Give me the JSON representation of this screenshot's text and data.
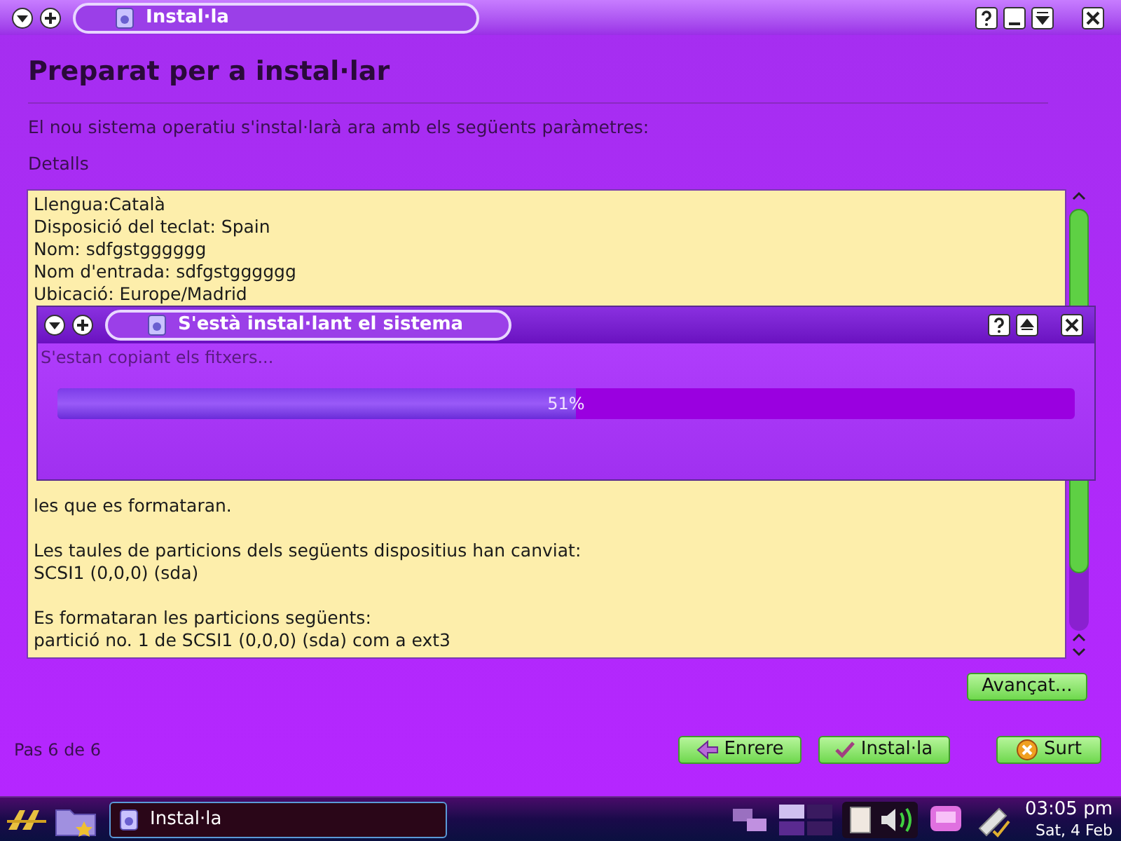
{
  "window": {
    "title": "Instal·la"
  },
  "page": {
    "heading": "Preparat per a instal·lar",
    "intro": "El nou sistema operatiu s'instal·larà ara amb els següents paràmetres:",
    "details_label": "Detalls",
    "details_top": [
      "Llengua:Català",
      "Disposició del teclat: Spain",
      "Nom: sdfgstgggggg",
      "Nom d'entrada: sdfgstgggggg",
      "Ubicació: Europe/Madrid"
    ],
    "details_bottom": [
      [
        "les que es formataran."
      ],
      [
        "Les taules de particions dels següents dispositius han canviat:",
        "SCSI1 (0,0,0) (sda)"
      ],
      [
        "Es formataran les particions següents:",
        "partició no. 1 de SCSI1 (0,0,0) (sda) com a ext3"
      ]
    ]
  },
  "dialog": {
    "title": "S'està instal·lant el sistema",
    "status": "S'estan copiant els fitxers...",
    "progress": {
      "level": 0.51,
      "reading": "51%"
    }
  },
  "advanced_button": "Avançat...",
  "step": "Pas 6 de 6",
  "buttons": [
    {
      "label": "Enrere",
      "kind": "back"
    },
    {
      "label": "Instal·la",
      "kind": "install"
    },
    {
      "label": "Surt",
      "kind": "quit"
    }
  ],
  "taskbar": {
    "tasks": [
      {
        "label": "Instal·la",
        "selected": true
      }
    ],
    "clock": {
      "time": "03:05 pm",
      "date": "Sat, 4 Feb"
    }
  }
}
